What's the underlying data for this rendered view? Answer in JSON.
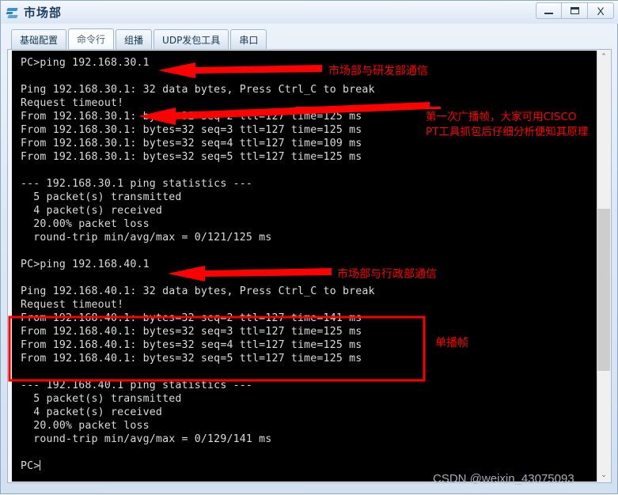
{
  "window": {
    "title": "市场部",
    "icon": "network-device-icon",
    "buttons": {
      "minimize": "–",
      "maximize": "❐",
      "close": "X"
    }
  },
  "tabs": [
    {
      "label": "基础配置",
      "active": false
    },
    {
      "label": "命令行",
      "active": true
    },
    {
      "label": "组播",
      "active": false
    },
    {
      "label": "UDP发包工具",
      "active": false
    },
    {
      "label": "串口",
      "active": false
    }
  ],
  "console": {
    "text": "PC>ping 192.168.30.1\n\nPing 192.168.30.1: 32 data bytes, Press Ctrl_C to break\nRequest timeout!\nFrom 192.168.30.1: bytes=32 seq=2 ttl=127 time=125 ms\nFrom 192.168.30.1: bytes=32 seq=3 ttl=127 time=125 ms\nFrom 192.168.30.1: bytes=32 seq=4 ttl=127 time=109 ms\nFrom 192.168.30.1: bytes=32 seq=5 ttl=127 time=125 ms\n\n--- 192.168.30.1 ping statistics ---\n  5 packet(s) transmitted\n  4 packet(s) received\n  20.00% packet loss\n  round-trip min/avg/max = 0/121/125 ms\n\nPC>ping 192.168.40.1\n\nPing 192.168.40.1: 32 data bytes, Press Ctrl_C to break\nRequest timeout!\nFrom 192.168.40.1: bytes=32 seq=2 ttl=127 time=141 ms\nFrom 192.168.40.1: bytes=32 seq=3 ttl=127 time=125 ms\nFrom 192.168.40.1: bytes=32 seq=4 ttl=127 time=125 ms\nFrom 192.168.40.1: bytes=32 seq=5 ttl=127 time=125 ms\n\n--- 192.168.40.1 ping statistics ---\n  5 packet(s) transmitted\n  4 packet(s) received\n  20.00% packet loss\n  round-trip min/avg/max = 0/129/141 ms\n\nPC>",
    "prompt": "PC>"
  },
  "annotations": {
    "arrow1_label": "市场部与研发部通信",
    "arrow2_label": "第一次广播帧，大家可用CISCO\nPT工具抓包后仔细分析便知其原理",
    "arrow3_label": "市场部与行政部通信",
    "box_label": "单播帧",
    "color": "#ff0000"
  },
  "scrollbar": {
    "up_arrow": "⌃",
    "down_arrow": "⌄"
  },
  "watermark": "CSDN @weixin_43075093"
}
